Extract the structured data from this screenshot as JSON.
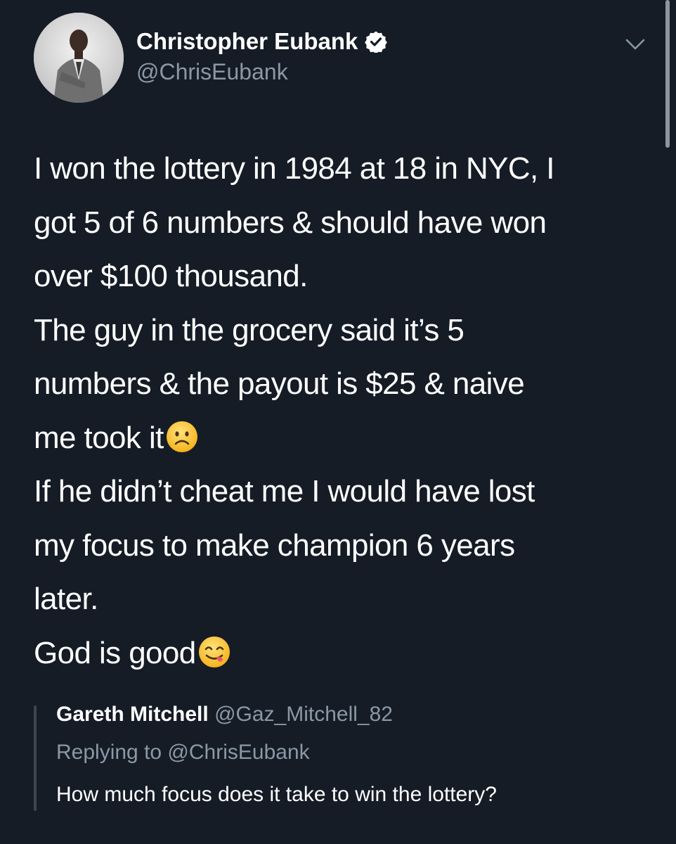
{
  "tweet": {
    "author": {
      "display_name": "Christopher Eubank",
      "handle": "@ChrisEubank",
      "verified": true,
      "avatar_icon": "profile-photo"
    },
    "menu_icon": "chevron-down-icon",
    "body_lines": [
      "I won the lottery in 1984 at 18 in NYC, I",
      "got 5 of 6 numbers & should have won",
      "over $100 thousand.",
      "The guy in the grocery said it’s 5",
      "numbers & the payout is $25 & naive",
      "me took it",
      "If he didn’t cheat me I would have lost",
      "my focus to make champion 6 years",
      "later.",
      "God is good"
    ],
    "emojis": {
      "sad": "frowning-face-emoji",
      "yum": "face-savoring-food-emoji"
    },
    "quoted": {
      "display_name": "Gareth Mitchell",
      "handle": "@Gaz_Mitchell_82",
      "reply_prefix": "Replying to @ChrisEubank",
      "text": "How much focus does it take to win the lottery?"
    }
  },
  "colors": {
    "background": "#151c26",
    "primary_text": "#ffffff",
    "secondary_text": "#8b98a5",
    "quote_bar": "#3d4650"
  }
}
